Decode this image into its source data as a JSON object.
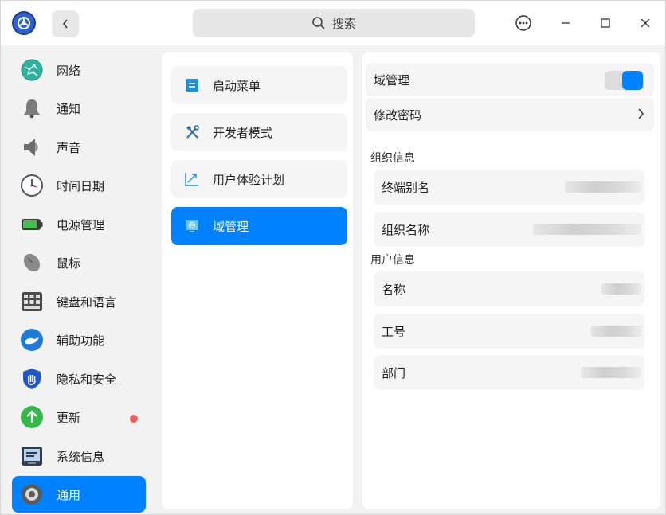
{
  "search": {
    "label": "搜索"
  },
  "nav": {
    "items": [
      {
        "label": "网络",
        "icon": "network-globe-icon"
      },
      {
        "label": "通知",
        "icon": "bell-icon"
      },
      {
        "label": "声音",
        "icon": "speaker-icon"
      },
      {
        "label": "时间日期",
        "icon": "clock-icon"
      },
      {
        "label": "电源管理",
        "icon": "battery-icon"
      },
      {
        "label": "鼠标",
        "icon": "mouse-icon"
      },
      {
        "label": "键盘和语言",
        "icon": "keyboard-icon"
      },
      {
        "label": "辅助功能",
        "icon": "accessibility-hand-icon"
      },
      {
        "label": "隐私和安全",
        "icon": "privacy-shield-icon"
      },
      {
        "label": "更新",
        "icon": "update-arrow-icon"
      },
      {
        "label": "系统信息",
        "icon": "system-info-icon"
      },
      {
        "label": "通用",
        "icon": "gear-icon"
      }
    ],
    "active_index": 11
  },
  "submenu": {
    "items": [
      {
        "label": "启动菜单",
        "icon": "boot-menu-icon"
      },
      {
        "label": "开发者模式",
        "icon": "developer-tools-icon"
      },
      {
        "label": "用户体验计划",
        "icon": "user-experience-icon"
      },
      {
        "label": "域管理",
        "icon": "domain-management-icon"
      }
    ],
    "active_index": 3
  },
  "domain": {
    "toggle_label": "域管理",
    "toggle_on": true,
    "change_password_label": "修改密码",
    "org_section_title": "组织信息",
    "terminal_alias_label": "终端别名",
    "org_name_label": "组织名称",
    "user_section_title": "用户信息",
    "name_label": "名称",
    "employee_id_label": "工号",
    "department_label": "部门"
  },
  "colors": {
    "accent": "#0081ff",
    "update_badge": "#f05a5a"
  }
}
